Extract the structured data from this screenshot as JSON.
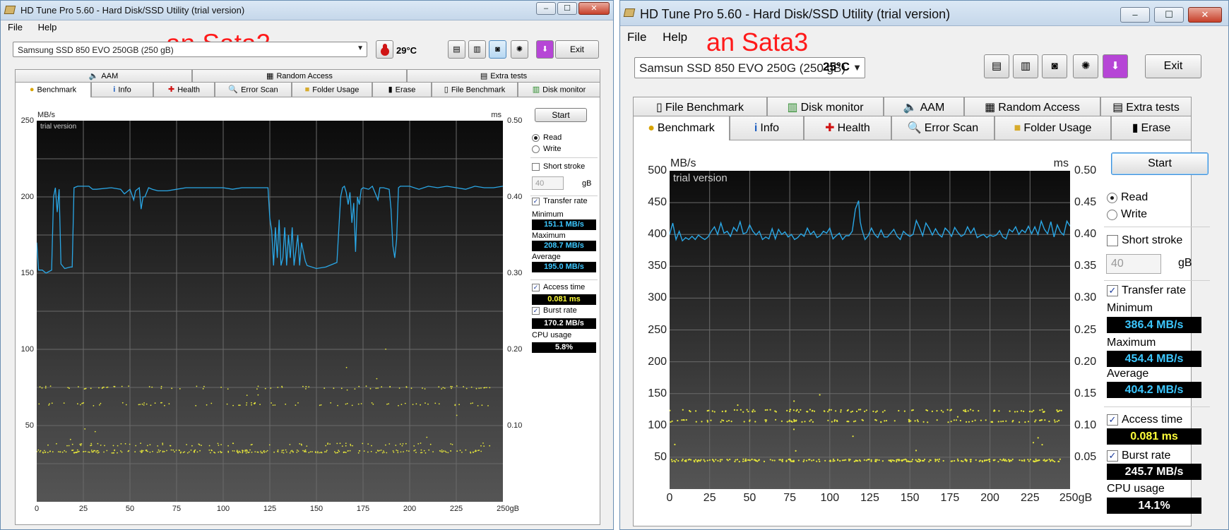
{
  "left": {
    "title": "HD Tune Pro 5.60 - Hard Disk/SSD Utility (trial version)",
    "menu": [
      "File",
      "Help"
    ],
    "annotation": "an Sata2",
    "drive": "Samsung SSD 850 EVO 250GB (250 gB)",
    "temperature": "29°C",
    "exit": "Exit",
    "tabs_top": [
      "AAM",
      "Random Access",
      "Extra tests"
    ],
    "tabs_bottom": [
      "Benchmark",
      "Info",
      "Health",
      "Error Scan",
      "Folder Usage",
      "Erase",
      "File Benchmark",
      "Disk monitor"
    ],
    "start": "Start",
    "read": "Read",
    "write": "Write",
    "short_stroke": "Short stroke",
    "stroke_value": "40",
    "stroke_unit": "gB",
    "transfer_rate": "Transfer rate",
    "minimum_label": "Minimum",
    "minimum": "151.1 MB/s",
    "maximum_label": "Maximum",
    "maximum": "208.7 MB/s",
    "average_label": "Average",
    "average": "195.0 MB/s",
    "access_time": "Access time",
    "access_value": "0.081 ms",
    "burst_rate": "Burst rate",
    "burst_value": "170.2 MB/s",
    "cpu_usage": "CPU usage",
    "cpu_value": "5.8%",
    "trial": "trial version",
    "win_buttons": [
      "–",
      "☐",
      "✕"
    ]
  },
  "right": {
    "title": "HD Tune Pro 5.60 - Hard Disk/SSD Utility (trial version)",
    "menu": [
      "File",
      "Help"
    ],
    "annotation": "an Sata3",
    "drive": "Samsun SSD 850 EVO 250G (250 gB)",
    "temperature": "25°C",
    "exit": "Exit",
    "tabs_top": [
      "File Benchmark",
      "Disk monitor",
      "AAM",
      "Random Access",
      "Extra tests"
    ],
    "tabs_bottom": [
      "Benchmark",
      "Info",
      "Health",
      "Error Scan",
      "Folder Usage",
      "Erase"
    ],
    "start": "Start",
    "read": "Read",
    "write": "Write",
    "short_stroke": "Short stroke",
    "stroke_value": "40",
    "stroke_unit": "gB",
    "transfer_rate": "Transfer rate",
    "minimum_label": "Minimum",
    "minimum": "386.4 MB/s",
    "maximum_label": "Maximum",
    "maximum": "454.4 MB/s",
    "average_label": "Average",
    "average": "404.2 MB/s",
    "access_time": "Access time",
    "access_value": "0.081 ms",
    "burst_rate": "Burst rate",
    "burst_value": "245.7 MB/s",
    "cpu_usage": "CPU usage",
    "cpu_value": "14.1%",
    "trial": "trial version",
    "win_buttons": [
      "–",
      "☐",
      "✕"
    ]
  },
  "colors": {
    "transfer_line": "#2aa7e6",
    "access_points": "#e6e63a",
    "red_note": "#ff1a1a"
  },
  "chart_data": [
    {
      "type": "line",
      "yunit": "MB/s",
      "y2unit": "ms",
      "xunit": "gB",
      "xticks": [
        "0",
        "25",
        "50",
        "75",
        "100",
        "125",
        "150",
        "175",
        "200",
        "225",
        "250gB"
      ],
      "yticks": [
        "50",
        "100",
        "150",
        "200",
        "250"
      ],
      "y2ticks": [
        "0.10",
        "0.20",
        "0.30",
        "0.40",
        "0.50"
      ],
      "ylim": [
        0,
        250
      ],
      "y2lim": [
        0,
        0.5
      ],
      "xlim": [
        0,
        250
      ],
      "series": [
        {
          "values": [
            [
              0,
              170
            ],
            [
              1,
              152
            ],
            [
              3,
              152
            ],
            [
              5,
              150
            ],
            [
              8,
              152
            ],
            [
              9,
              200
            ],
            [
              10,
              206
            ],
            [
              11,
              190
            ],
            [
              12,
              205
            ],
            [
              13,
              156
            ],
            [
              15,
              153
            ],
            [
              18,
              154
            ],
            [
              19,
              154
            ],
            [
              20,
              206
            ],
            [
              22,
              207
            ],
            [
              25,
              207
            ],
            [
              28,
              207
            ],
            [
              30,
              205
            ],
            [
              32,
              205
            ],
            [
              40,
              206
            ],
            [
              45,
              205
            ],
            [
              47,
              202
            ],
            [
              50,
              205
            ],
            [
              52,
              198
            ],
            [
              53,
              204
            ],
            [
              55,
              206
            ],
            [
              56,
              192
            ],
            [
              57,
              200
            ],
            [
              58,
              200
            ],
            [
              60,
              206
            ],
            [
              62,
              205
            ],
            [
              65,
              204
            ],
            [
              70,
              204
            ],
            [
              75,
              205
            ],
            [
              80,
              206
            ],
            [
              85,
              206
            ],
            [
              90,
              206
            ],
            [
              95,
              206
            ],
            [
              100,
              206
            ],
            [
              105,
              205
            ],
            [
              110,
              206
            ],
            [
              115,
              206
            ],
            [
              120,
              206
            ],
            [
              124,
              206
            ],
            [
              125,
              186
            ],
            [
              126,
              178
            ],
            [
              127,
              155
            ],
            [
              128,
              180
            ],
            [
              129,
              160
            ],
            [
              130,
              185
            ],
            [
              131,
              155
            ],
            [
              132,
              160
            ],
            [
              133,
              180
            ],
            [
              134,
              155
            ],
            [
              135,
              175
            ],
            [
              136,
              160
            ],
            [
              137,
              180
            ],
            [
              138,
              155
            ],
            [
              139,
              165
            ],
            [
              140,
              175
            ],
            [
              141,
              155
            ],
            [
              142,
              170
            ],
            [
              144,
              158
            ],
            [
              145,
              155
            ],
            [
              150,
              153
            ],
            [
              155,
              154
            ],
            [
              161,
              157
            ],
            [
              163,
              200
            ],
            [
              164,
              206
            ],
            [
              165,
              207
            ],
            [
              166,
              203
            ],
            [
              167,
              195
            ],
            [
              168,
              203
            ],
            [
              169,
              183
            ],
            [
              170,
              196
            ],
            [
              171,
              164
            ],
            [
              172,
              200
            ],
            [
              173,
              195
            ],
            [
              174,
              205
            ],
            [
              175,
              206
            ],
            [
              178,
              205
            ],
            [
              180,
              207
            ],
            [
              183,
              198
            ],
            [
              184,
              206
            ],
            [
              186,
              206
            ],
            [
              189,
              205
            ],
            [
              190,
              192
            ],
            [
              191,
              168
            ],
            [
              192,
              160
            ],
            [
              193,
              172
            ],
            [
              194,
              206
            ],
            [
              195,
              207
            ],
            [
              200,
              207
            ],
            [
              205,
              205
            ],
            [
              210,
              207
            ],
            [
              215,
              206
            ],
            [
              220,
              207
            ],
            [
              225,
              206
            ],
            [
              230,
              205
            ],
            [
              235,
              207
            ],
            [
              240,
              206
            ],
            [
              245,
              206
            ],
            [
              250,
              207
            ]
          ]
        }
      ],
      "access_bands_ms": [
        0.066,
        0.075,
        0.128,
        0.15
      ]
    },
    {
      "type": "line",
      "yunit": "MB/s",
      "y2unit": "ms",
      "xunit": "gB",
      "xticks": [
        "0",
        "25",
        "50",
        "75",
        "100",
        "125",
        "150",
        "175",
        "200",
        "225",
        "250gB"
      ],
      "yticks": [
        "50",
        "100",
        "150",
        "200",
        "250",
        "300",
        "350",
        "400",
        "450",
        "500"
      ],
      "y2ticks": [
        "0.05",
        "0.10",
        "0.15",
        "0.20",
        "0.25",
        "0.30",
        "0.35",
        "0.40",
        "0.45",
        "0.50"
      ],
      "ylim": [
        0,
        500
      ],
      "y2lim": [
        0,
        0.5
      ],
      "xlim": [
        0,
        250
      ],
      "series": [
        {
          "values": [
            [
              0,
              400
            ],
            [
              2,
              418
            ],
            [
              4,
              392
            ],
            [
              6,
              405
            ],
            [
              8,
              390
            ],
            [
              10,
              395
            ],
            [
              12,
              392
            ],
            [
              14,
              397
            ],
            [
              16,
              392
            ],
            [
              18,
              399
            ],
            [
              20,
              395
            ],
            [
              22,
              392
            ],
            [
              24,
              396
            ],
            [
              26,
              405
            ],
            [
              28,
              412
            ],
            [
              30,
              400
            ],
            [
              32,
              418
            ],
            [
              34,
              402
            ],
            [
              36,
              405
            ],
            [
              38,
              397
            ],
            [
              40,
              411
            ],
            [
              42,
              405
            ],
            [
              44,
              420
            ],
            [
              46,
              401
            ],
            [
              48,
              403
            ],
            [
              50,
              415
            ],
            [
              52,
              405
            ],
            [
              54,
              399
            ],
            [
              56,
              405
            ],
            [
              58,
              392
            ],
            [
              60,
              396
            ],
            [
              62,
              393
            ],
            [
              64,
              409
            ],
            [
              66,
              393
            ],
            [
              68,
              408
            ],
            [
              70,
              400
            ],
            [
              72,
              404
            ],
            [
              74,
              396
            ],
            [
              76,
              400
            ],
            [
              78,
              392
            ],
            [
              80,
              395
            ],
            [
              82,
              401
            ],
            [
              84,
              397
            ],
            [
              86,
              410
            ],
            [
              88,
              400
            ],
            [
              90,
              405
            ],
            [
              92,
              395
            ],
            [
              94,
              398
            ],
            [
              96,
              405
            ],
            [
              98,
              402
            ],
            [
              100,
              410
            ],
            [
              102,
              393
            ],
            [
              104,
              398
            ],
            [
              106,
              402
            ],
            [
              108,
              392
            ],
            [
              110,
              398
            ],
            [
              112,
              398
            ],
            [
              114,
              405
            ],
            [
              116,
              440
            ],
            [
              118,
              453
            ],
            [
              119,
              420
            ],
            [
              120,
              408
            ],
            [
              122,
              392
            ],
            [
              124,
              398
            ],
            [
              126,
              410
            ],
            [
              128,
              400
            ],
            [
              130,
              395
            ],
            [
              132,
              407
            ],
            [
              134,
              396
            ],
            [
              136,
              396
            ],
            [
              138,
              402
            ],
            [
              140,
              408
            ],
            [
              142,
              397
            ],
            [
              144,
              392
            ],
            [
              146,
              405
            ],
            [
              148,
              400
            ],
            [
              150,
              397
            ],
            [
              152,
              400
            ],
            [
              154,
              422
            ],
            [
              156,
              411
            ],
            [
              158,
              398
            ],
            [
              160,
              418
            ],
            [
              162,
              410
            ],
            [
              164,
              399
            ],
            [
              166,
              409
            ],
            [
              168,
              400
            ],
            [
              170,
              396
            ],
            [
              172,
              410
            ],
            [
              174,
              405
            ],
            [
              176,
              397
            ],
            [
              178,
              411
            ],
            [
              180,
              403
            ],
            [
              182,
              397
            ],
            [
              184,
              400
            ],
            [
              186,
              412
            ],
            [
              188,
              402
            ],
            [
              190,
              410
            ],
            [
              192,
              395
            ],
            [
              194,
              398
            ],
            [
              196,
              400
            ],
            [
              198,
              395
            ],
            [
              200,
              399
            ],
            [
              202,
              397
            ],
            [
              204,
              399
            ],
            [
              206,
              406
            ],
            [
              208,
              396
            ],
            [
              210,
              393
            ],
            [
              212,
              408
            ],
            [
              214,
              404
            ],
            [
              216,
              412
            ],
            [
              218,
              400
            ],
            [
              220,
              407
            ],
            [
              222,
              403
            ],
            [
              224,
              413
            ],
            [
              226,
              401
            ],
            [
              228,
              412
            ],
            [
              230,
              400
            ],
            [
              232,
              421
            ],
            [
              234,
              408
            ],
            [
              236,
              401
            ],
            [
              238,
              420
            ],
            [
              240,
              396
            ],
            [
              242,
              415
            ],
            [
              244,
              404
            ],
            [
              246,
              399
            ],
            [
              248,
              421
            ],
            [
              250,
              413
            ]
          ]
        }
      ],
      "access_bands_ms": [
        0.045,
        0.107,
        0.123
      ]
    }
  ]
}
